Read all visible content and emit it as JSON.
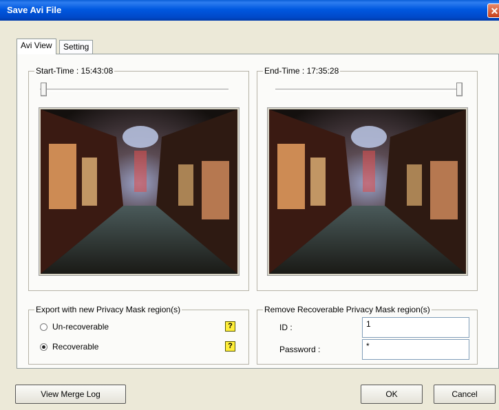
{
  "window": {
    "title": "Save Avi File",
    "close_glyph": "✕"
  },
  "tabs": [
    {
      "label": "Avi View",
      "active": true
    },
    {
      "label": "Setting",
      "active": false
    }
  ],
  "avi_view": {
    "start": {
      "label": "Start-Time : 15:43:08",
      "slider_value": 0.0
    },
    "end": {
      "label": "End-Time : 17:35:28",
      "slider_value": 1.0
    }
  },
  "export_mask": {
    "label": "Export with new Privacy Mask region(s)",
    "options": [
      {
        "label": "Un-recoverable",
        "selected": false,
        "help": "?"
      },
      {
        "label": "Recoverable",
        "selected": true,
        "help": "?"
      }
    ]
  },
  "remove_mask": {
    "label": "Remove Recoverable Privacy Mask region(s)",
    "id_label": "ID :",
    "id_value": "1",
    "password_label": "Password :",
    "password_value": "*"
  },
  "buttons": {
    "view_merge_log": "View Merge Log",
    "ok": "OK",
    "cancel": "Cancel"
  },
  "colors": {
    "titlebar": "#0054e3",
    "dialog_bg": "#ece9d8",
    "panel_bg": "#fbfbf9"
  }
}
